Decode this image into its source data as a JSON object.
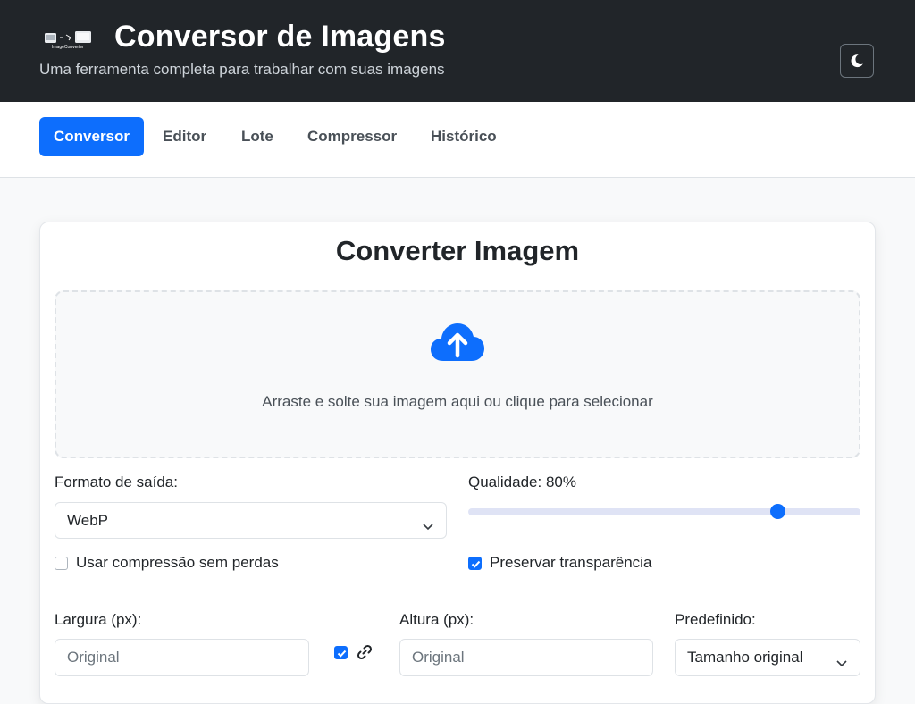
{
  "header": {
    "logo_text": "ImageConverter",
    "title": "Conversor de Imagens",
    "subtitle": "Uma ferramenta completa para trabalhar com suas imagens",
    "theme_toggle_icon": "moon-icon"
  },
  "nav": {
    "tabs": [
      {
        "label": "Conversor",
        "active": true
      },
      {
        "label": "Editor",
        "active": false
      },
      {
        "label": "Lote",
        "active": false
      },
      {
        "label": "Compressor",
        "active": false
      },
      {
        "label": "Histórico",
        "active": false
      }
    ]
  },
  "converter": {
    "title": "Converter Imagem",
    "dropzone_icon": "cloud-upload-icon",
    "dropzone_text": "Arraste e solte sua imagem aqui ou clique para selecionar",
    "output_format_label": "Formato de saída:",
    "output_format_value": "WebP",
    "quality_label": "Qualidade: 80%",
    "quality_value": 80,
    "lossless_label": "Usar compressão sem perdas",
    "lossless_checked": false,
    "preserve_transparency_label": "Preservar transparência",
    "preserve_transparency_checked": true,
    "width_label": "Largura (px):",
    "width_placeholder": "Original",
    "aspect_lock_checked": true,
    "aspect_lock_icon": "link-icon",
    "height_label": "Altura (px):",
    "height_placeholder": "Original",
    "preset_label": "Predefinido:",
    "preset_value": "Tamanho original"
  },
  "colors": {
    "header_bg": "#212529",
    "accent": "#0d6efd",
    "page_bg": "#f8f9fa"
  }
}
